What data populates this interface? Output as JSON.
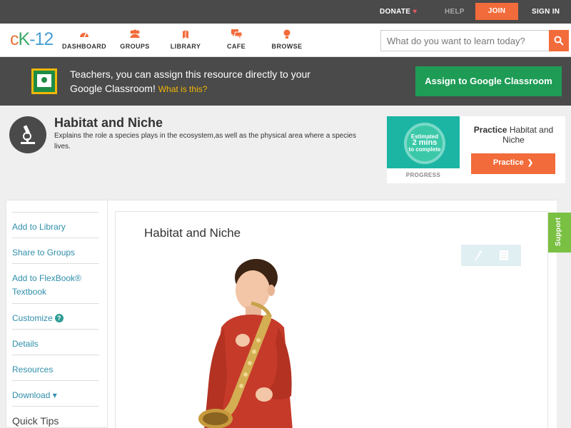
{
  "topbar": {
    "donate": "DONATE",
    "help": "HELP",
    "join": "JOIN",
    "signin": "SIGN IN"
  },
  "nav": {
    "logo": {
      "c": "c",
      "k": "K",
      "n": "-12"
    },
    "items": [
      {
        "label": "DASHBOARD",
        "icon": "dashboard-icon"
      },
      {
        "label": "GROUPS",
        "icon": "groups-icon"
      },
      {
        "label": "LIBRARY",
        "icon": "library-icon"
      },
      {
        "label": "CAFE",
        "icon": "cafe-icon"
      },
      {
        "label": "BROWSE",
        "icon": "browse-icon"
      }
    ],
    "search_placeholder": "What do you want to learn today?"
  },
  "banner": {
    "text": "Teachers, you can assign this resource directly to your Google Classroom!",
    "what": "What is this?",
    "button": "Assign to Google Classroom"
  },
  "concept": {
    "title": "Habitat and Niche",
    "description": "Explains the role a species plays in the ecosystem,as well as the physical area where a species lives."
  },
  "practice": {
    "estimated_line1": "Estimated",
    "estimated_line2": "2 mins",
    "estimated_line3": "to complete",
    "progress_label": "PROGRESS",
    "title_bold": "Practice",
    "title_rest": " Habitat and Niche",
    "button": "Practice"
  },
  "sidebar": {
    "items": [
      "Add to Library",
      "Share to Groups",
      "Add to FlexBook® Textbook",
      "Customize",
      "Details",
      "Resources",
      "Download ▾",
      "Quick Tips"
    ]
  },
  "content": {
    "title": "Habitat and Niche"
  },
  "support": "Support",
  "colors": {
    "accent": "#f26b3a",
    "google_green": "#1e9c56",
    "link": "#2f8fab"
  }
}
